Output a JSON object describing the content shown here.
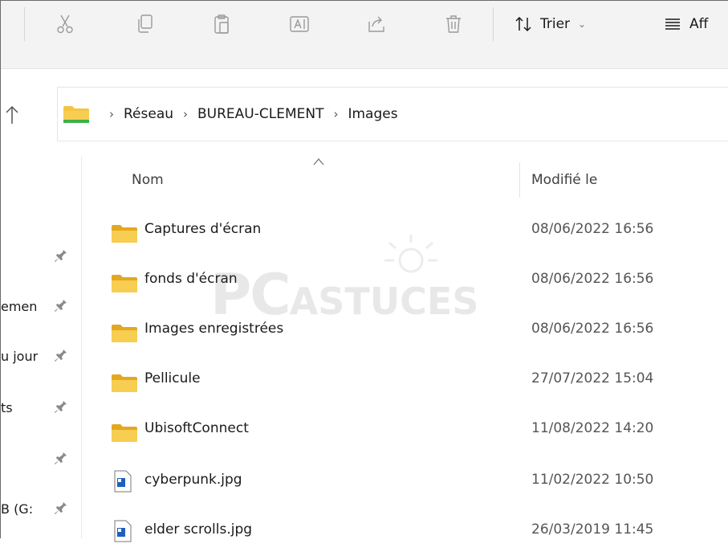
{
  "toolbar": {
    "sort_label": "Trier",
    "view_label": "Aff"
  },
  "address_bar": {
    "crumbs": [
      "Réseau",
      "BUREAU-CLEMENT",
      "Images"
    ]
  },
  "nav_pane": {
    "items": [
      "emen",
      "u jour",
      "ts",
      "",
      "B (G:"
    ]
  },
  "file_list": {
    "columns": {
      "name": "Nom",
      "modified": "Modifié le"
    },
    "rows": [
      {
        "name": "Captures d'écran",
        "modified": "08/06/2022 16:56",
        "type": "folder"
      },
      {
        "name": "fonds d'écran",
        "modified": "08/06/2022 16:56",
        "type": "folder"
      },
      {
        "name": "Images enregistrées",
        "modified": "08/06/2022 16:56",
        "type": "folder"
      },
      {
        "name": "Pellicule",
        "modified": "27/07/2022 15:04",
        "type": "folder"
      },
      {
        "name": "UbisoftConnect",
        "modified": "11/08/2022 14:20",
        "type": "folder"
      },
      {
        "name": "cyberpunk.jpg",
        "modified": "11/02/2022 10:50",
        "type": "image-file"
      },
      {
        "name": "elder scrolls.jpg",
        "modified": "26/03/2019 11:45",
        "type": "image-file"
      }
    ]
  },
  "watermark": {
    "part1": "PC",
    "part2": "ASTUCES"
  },
  "colors": {
    "folder": "#f4c542",
    "folder_dark": "#e3a821",
    "network_green": "#3cb04a",
    "file_blue": "#1f5fbf"
  }
}
